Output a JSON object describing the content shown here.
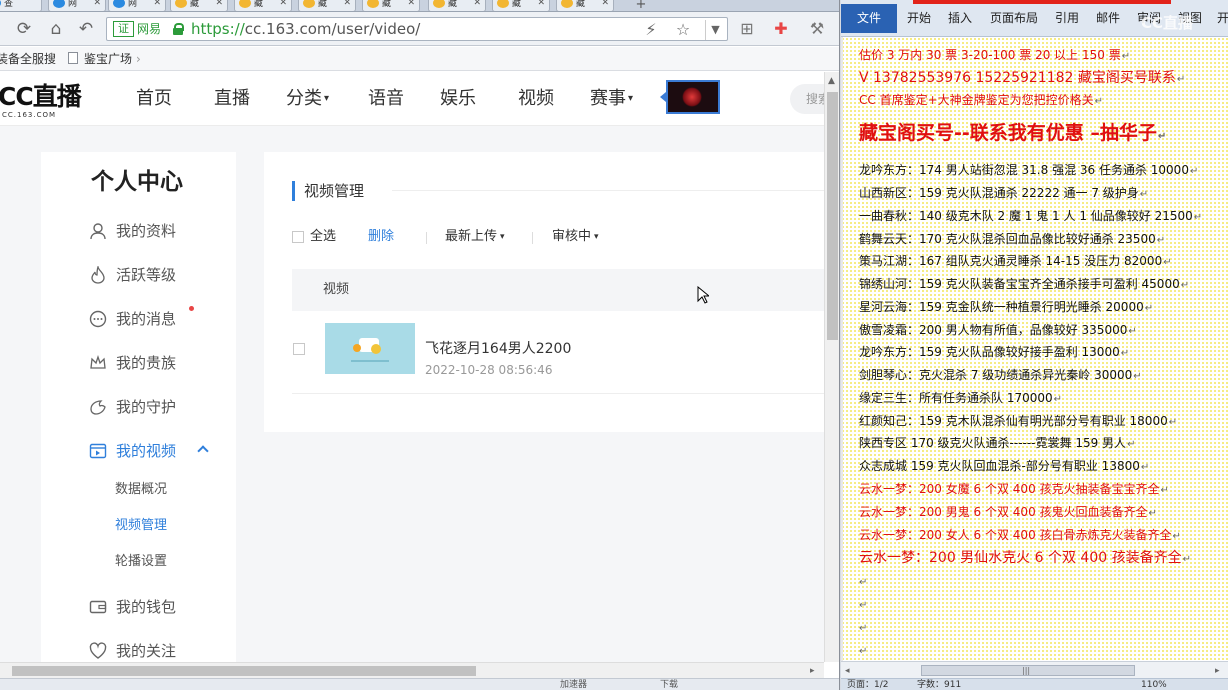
{
  "browser": {
    "tabs": [
      {
        "label": "查",
        "icon": "ie-icon"
      },
      {
        "label": "网",
        "icon": "globe-icon"
      },
      {
        "label": "网",
        "icon": "globe-icon"
      },
      {
        "label": "藏",
        "icon": "treasure-icon"
      },
      {
        "label": "藏",
        "icon": "treasure-icon"
      },
      {
        "label": "藏",
        "icon": "treasure-icon"
      },
      {
        "label": "藏",
        "icon": "treasure-icon"
      },
      {
        "label": "藏",
        "icon": "treasure-icon"
      },
      {
        "label": "藏",
        "icon": "treasure-icon"
      },
      {
        "label": "藏",
        "icon": "treasure-icon"
      },
      {
        "label": "藏",
        "icon": "treasure-icon"
      }
    ],
    "new_tab": "+",
    "cert_badge": "证",
    "site_label": "网易",
    "url_scheme": "https://",
    "url_rest": "cc.163.com/user/video/",
    "bookmarks": [
      "装备全服搜",
      "鉴宝广场"
    ],
    "bookmark_arrow": "›",
    "status_left": "加速器",
    "status_right": "下载"
  },
  "site": {
    "logo_big": "CC直播",
    "logo_small": "CC.163.COM",
    "nav": [
      {
        "label": "首页",
        "caret": ""
      },
      {
        "label": "直播",
        "caret": ""
      },
      {
        "label": "分类",
        "caret": "▾"
      },
      {
        "label": "语音",
        "caret": ""
      },
      {
        "label": "娱乐",
        "caret": ""
      },
      {
        "label": "视频",
        "caret": ""
      },
      {
        "label": "赛事",
        "caret": "▾"
      }
    ],
    "search_placeholder": "搜索"
  },
  "sidebar": {
    "title": "个人中心",
    "items": [
      {
        "label": "我的资料",
        "icon": "user-icon"
      },
      {
        "label": "活跃等级",
        "icon": "flame-icon"
      },
      {
        "label": "我的消息",
        "icon": "message-icon"
      },
      {
        "label": "我的贵族",
        "icon": "crown-icon"
      },
      {
        "label": "我的守护",
        "icon": "guard-icon"
      },
      {
        "label": "我的视频",
        "icon": "video-icon"
      },
      {
        "label": "我的钱包",
        "icon": "wallet-icon"
      },
      {
        "label": "我的关注",
        "icon": "heart-icon"
      }
    ],
    "sub_items": [
      "数据概况",
      "视频管理",
      "轮播设置"
    ]
  },
  "content": {
    "title": "视频管理",
    "select_all": "全选",
    "delete": "删除",
    "sort": "最新上传",
    "review": "审核中",
    "dropdown_caret": "▾",
    "column_header": "视频",
    "videos": [
      {
        "title": "飞花逐月164男人2200",
        "date": "2022-10-28 08:56:46"
      }
    ]
  },
  "word": {
    "tabs": [
      "文件",
      "开始",
      "插入",
      "页面布局",
      "引用",
      "邮件",
      "审阅",
      "视图",
      "开"
    ],
    "watermark": "CC直播",
    "lines": [
      {
        "text": "估价 3 万内 30 票    3-20-100 票      20 以上 150 票",
        "style": "red"
      },
      {
        "text": "V 13782553976    15225921182  藏宝阁买号联系",
        "style": "medred"
      },
      {
        "text": "CC 首席鉴定+大神金牌鉴定为您把控价格关",
        "style": "red"
      },
      {
        "text": "藏宝阁买号--联系我有优惠 –抽华子",
        "style": "bigred"
      },
      {
        "text": "龙吟东方：174 男人站街忽混 31.8 强混 36 任务通杀 10000",
        "style": "normal"
      },
      {
        "text": "山西新区：159 克火队混通杀 22222 通一 7 级护身",
        "style": "normal"
      },
      {
        "text": "一曲春秋：140 级克木队 2 魔 1 鬼 1 人 1 仙品像较好 21500",
        "style": "normal"
      },
      {
        "text": "鹤舞云天：170 克火队混杀回血品像比较好通杀 23500",
        "style": "normal"
      },
      {
        "text": "策马江湖：167 组队克火通灵睡杀 14-15 没压力 82000",
        "style": "normal"
      },
      {
        "text": "锦绣山河：159 克火队装备宝宝齐全通杀接手可盈利 45000",
        "style": "normal"
      },
      {
        "text": "星河云海：159 克金队统一种植景行明光睡杀 20000",
        "style": "normal"
      },
      {
        "text": "傲雪凌霜：200 男人物有所值，品像较好 335000",
        "style": "normal"
      },
      {
        "text": "龙吟东方：159 克火队品像较好接手盈利 13000",
        "style": "normal"
      },
      {
        "text": "剑胆琴心：克火混杀 7 级功绩通杀异光秦岭 30000",
        "style": "normal"
      },
      {
        "text": "缘定三生：所有任务通杀队 170000",
        "style": "normal"
      },
      {
        "text": "红颜知己：159 克木队混杀仙有明光部分号有职业 18000",
        "style": "normal"
      },
      {
        "text": "陕西专区 170 级克火队通杀------霓裳舞 159 男人",
        "style": "normal"
      },
      {
        "text": "众志成城 159 克火队回血混杀-部分号有职业 13800",
        "style": "normal"
      },
      {
        "text": "云水一梦：200 女魔 6 个双 400 孩克火抽装备宝宝齐全",
        "style": "red"
      },
      {
        "text": "云水一梦：200 男鬼 6 个双 400 孩鬼火回血装备齐全",
        "style": "red"
      },
      {
        "text": "云水一梦：200 女人 6 个双 400 孩白骨赤炼克火装备齐全",
        "style": "red"
      },
      {
        "text": "云水一梦：200 男仙水克火 6 个双 400 孩装备齐全",
        "style": "medred"
      }
    ],
    "para_mark": "↵",
    "scroll_grip": "|||",
    "status": [
      "页面：1/2",
      "字数：911",
      "110%"
    ]
  },
  "colors": {
    "accent_blue": "#2f7fdb",
    "word_red": "#e01010",
    "highlight_yellow": "#f2e34a",
    "file_tab": "#2a62b3"
  }
}
